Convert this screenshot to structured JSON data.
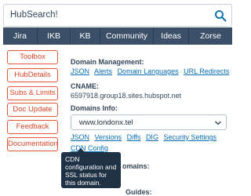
{
  "search": {
    "value": "HubSearch!",
    "icon": "search-icon"
  },
  "tabs": [
    "Jira",
    "IKB",
    "KB",
    "Community",
    "Ideas",
    "Zorse"
  ],
  "side_buttons": [
    "Toolbox",
    "HubDetails",
    "Subs & Limits",
    "Doc Update",
    "Feedback",
    "Documentation"
  ],
  "domain_management": {
    "label": "Domain Management:",
    "links": [
      "JSON",
      "Alerts",
      "Domain Languages",
      "URL Redirects"
    ]
  },
  "cname": {
    "label": "CNAME:",
    "value": "6597918.group18.sites.hubspot.net"
  },
  "domains_info": {
    "label": "Domains Info:",
    "selected": "www.londonx.tel",
    "links": [
      "JSON",
      "Versions",
      "Diffs",
      "DIG",
      "Security Settings"
    ],
    "config_link": "Config"
  },
  "tooltip": {
    "text": "CDN configuration and SSL status for this domain."
  },
  "partial_labels": {
    "domains_suffix": "omains:",
    "guides": "Guides:"
  },
  "colors": {
    "tab_bg": "#3b5068",
    "side_button_border": "#e0573a",
    "link": "#0a6fb5",
    "tooltip_bg": "#1f3144"
  }
}
